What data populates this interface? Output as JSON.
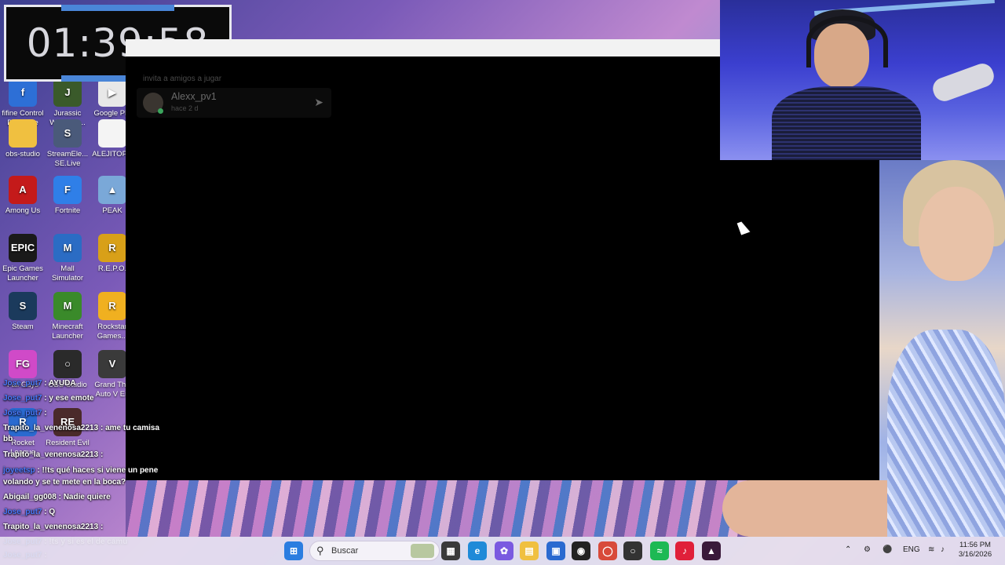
{
  "timer": {
    "value": "01:39:58"
  },
  "desktop_icons": [
    {
      "id": "fifine",
      "label": "fifine Control Deck.exe",
      "color": "#2d6fd6",
      "glyph": "f"
    },
    {
      "id": "jurassic",
      "label": "Jurassic World Ev...",
      "color": "#3a5a2a",
      "glyph": "J"
    },
    {
      "id": "googleplay",
      "label": "Google Pla Juegos",
      "color": "#e8e8e8",
      "glyph": "▶"
    },
    {
      "id": "obs-folder",
      "label": "obs-studio",
      "color": "#f0c040",
      "glyph": ""
    },
    {
      "id": "streamelements",
      "label": "StreamEle... SE.Live",
      "color": "#4a5a7a",
      "glyph": "S"
    },
    {
      "id": "alejitopc",
      "label": "ALEJITOPC",
      "color": "#f4f4f4",
      "glyph": ""
    },
    {
      "id": "amongus",
      "label": "Among Us",
      "color": "#c41a1a",
      "glyph": "A"
    },
    {
      "id": "fortnite",
      "label": "Fortnite",
      "color": "#2f7fe8",
      "glyph": "F"
    },
    {
      "id": "peak",
      "label": "PEAK",
      "color": "#7aa8d8",
      "glyph": "▲"
    },
    {
      "id": "epic",
      "label": "Epic Games Launcher",
      "color": "#1a1a1a",
      "glyph": "EPIC"
    },
    {
      "id": "mall",
      "label": "Mall Simulator",
      "color": "#2b6cc4",
      "glyph": "M"
    },
    {
      "id": "repo",
      "label": "R.E.P.O.",
      "color": "#d8a018",
      "glyph": "R"
    },
    {
      "id": "steam",
      "label": "Steam",
      "color": "#1b3a5c",
      "glyph": "S"
    },
    {
      "id": "minecraft",
      "label": "Minecraft Launcher",
      "color": "#3a8a2a",
      "glyph": "M"
    },
    {
      "id": "rockstar",
      "label": "Rockstar Games...",
      "color": "#f0b020",
      "glyph": "R"
    },
    {
      "id": "fallguys",
      "label": "Fall Guys",
      "color": "#d04ac8",
      "glyph": "FG"
    },
    {
      "id": "obs",
      "label": "OBS Studio",
      "color": "#2a2a2a",
      "glyph": "○"
    },
    {
      "id": "gta",
      "label": "Grand The Auto V En",
      "color": "#3a3a3a",
      "glyph": "V"
    },
    {
      "id": "rocket",
      "label": "Rocket League",
      "color": "#2a6ad0",
      "glyph": "R"
    },
    {
      "id": "resident",
      "label": "Resident Evil",
      "color": "#4a2a2a",
      "glyph": "RE"
    }
  ],
  "friend_panel": {
    "hint": "invita a amigos a jugar",
    "name": "Alexx_pv1",
    "sub": "hace 2 d"
  },
  "chat": [
    {
      "user": "Jose_put7",
      "msg": ": AYUDA",
      "alt": false
    },
    {
      "user": "Jose_put7",
      "msg": ": y ese emote",
      "alt": false
    },
    {
      "user": "Jose_put7",
      "msg": ":",
      "alt": false
    },
    {
      "user": "Trapito_la_venenosa2213",
      "msg": ": ame tu camisa",
      "alt": true
    },
    {
      "user": "bb",
      "msg": "",
      "alt": true
    },
    {
      "user": "Trapito_la_venenosa2213",
      "msg": ":",
      "alt": true
    },
    {
      "user": "joyeetsp",
      "msg": ": !!ts qué haces si viene un pene",
      "alt": false
    },
    {
      "user": "volando y se te mete en la boca?",
      "msg": "",
      "alt": true
    },
    {
      "user": "Abigail_gg008",
      "msg": ": Nadie quiere",
      "alt": true
    },
    {
      "user": "Jose_put7",
      "msg": ": Q",
      "alt": false
    },
    {
      "user": "Trapito_la_venenosa2213",
      "msg": ":",
      "alt": true
    },
    {
      "user": "Jose_put7",
      "msg": ": !ts y si es el de camu",
      "alt": false
    },
    {
      "user": "Jose_put7",
      "msg": ":",
      "alt": false
    }
  ],
  "taskbar": {
    "search_placeholder": "Buscar",
    "lang": "ENG",
    "time": "11:56 PM",
    "date": "3/16/2026"
  }
}
